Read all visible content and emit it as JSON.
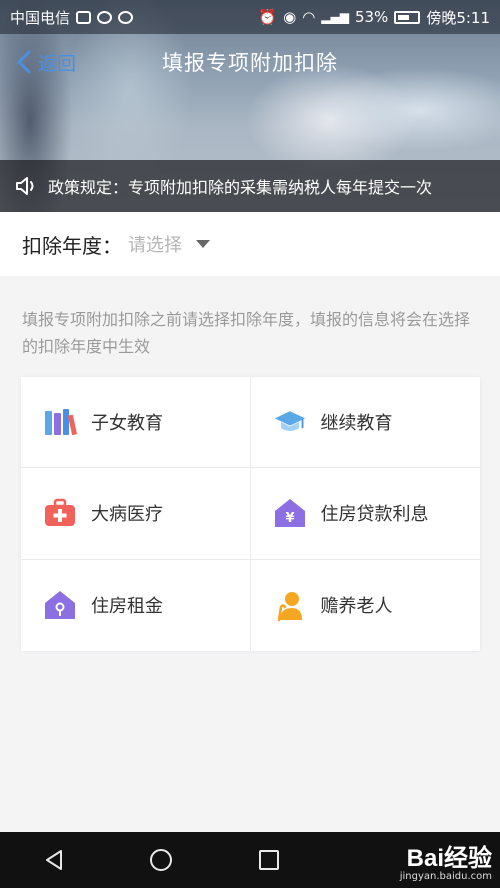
{
  "status_bar": {
    "carrier": "中国电信",
    "battery_percent": "53%",
    "time": "傍晚5:11"
  },
  "nav": {
    "back_label": "返回",
    "title": "填报专项附加扣除"
  },
  "policy": {
    "text": "政策规定：专项附加扣除的采集需纳税人每年提交一次"
  },
  "year_select": {
    "label": "扣除年度：",
    "placeholder": "请选择"
  },
  "hint": "填报专项附加扣除之前请选择扣除年度，填报的信息将会在选择的扣除年度中生效",
  "categories": [
    {
      "label": "子女教育",
      "icon": "books-icon"
    },
    {
      "label": "继续教育",
      "icon": "graduation-cap-icon"
    },
    {
      "label": "大病医疗",
      "icon": "medical-kit-icon"
    },
    {
      "label": "住房贷款利息",
      "icon": "house-yuan-icon"
    },
    {
      "label": "住房租金",
      "icon": "house-key-icon"
    },
    {
      "label": "赡养老人",
      "icon": "elderly-person-icon"
    }
  ],
  "watermark": {
    "main": "Bai经验",
    "sub": "jingyan.baidu.com"
  },
  "colors": {
    "accent": "#4a8fe6",
    "medical": "#f0625a",
    "house": "#8b6fe3",
    "cap": "#5aa8e8",
    "elderly": "#f5a623"
  }
}
